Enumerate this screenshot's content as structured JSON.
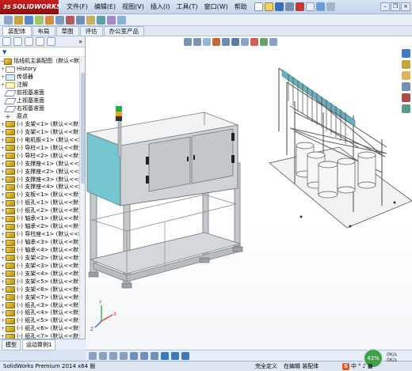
{
  "app": {
    "logo_prefix": "3S",
    "logo_text": "SOLIDWORKS",
    "menu": [
      "文件(F)",
      "编辑(E)",
      "视图(V)",
      "插入(I)",
      "工具(T)",
      "窗口(W)",
      "帮助"
    ]
  },
  "command_tabs": [
    "装配体",
    "布局",
    "草图",
    "评估",
    "办公室产品"
  ],
  "feature_tree": {
    "filter_icon": "filter-icon",
    "root": "括线机主装配图（默认<默认",
    "items": [
      {
        "label": "History",
        "icon": "hist"
      },
      {
        "label": "传感器",
        "icon": "sensor"
      },
      {
        "label": "注解",
        "icon": "note"
      },
      {
        "label": "前视基准面",
        "icon": "plane"
      },
      {
        "label": "上视基准面",
        "icon": "plane"
      },
      {
        "label": "右视基准面",
        "icon": "plane"
      },
      {
        "label": "原点",
        "icon": "origin"
      },
      {
        "label": "(-) 支架<1> (默认<<默认",
        "icon": "part"
      },
      {
        "label": "(-) 支架<1> (默认<<默认",
        "icon": "part"
      },
      {
        "label": "(-) 电机板<1> (默认<<默",
        "icon": "part"
      },
      {
        "label": "(-) 导柱<1> (默认<<默认",
        "icon": "part"
      },
      {
        "label": "(-) 导柱<2> (默认<<默认",
        "icon": "part"
      },
      {
        "label": "(-) 支撑座<1> (默认<<默",
        "icon": "part"
      },
      {
        "label": "(-) 支撑座<2> (默认<<默",
        "icon": "part"
      },
      {
        "label": "(-) 支撑座<3> (默认<<默",
        "icon": "part"
      },
      {
        "label": "(-) 支撑座<4> (默认<<默",
        "icon": "part"
      },
      {
        "label": "(-) 支板<1> (默认<<默认",
        "icon": "part"
      },
      {
        "label": "(-) 纸孔<1> (默认<<默认",
        "icon": "part"
      },
      {
        "label": "(-) 纸孔<2> (默认<<默认",
        "icon": "part"
      },
      {
        "label": "(-) 轴承<1> (默认<<默认",
        "icon": "part"
      },
      {
        "label": "(-) 轴承<2> (默认<<默认",
        "icon": "part"
      },
      {
        "label": "(-) 导柱座<1> (默认<<默",
        "icon": "part"
      },
      {
        "label": "(-) 轴承<3> (默认<<默认",
        "icon": "part"
      },
      {
        "label": "(-) 轴承<4> (默认<<默认",
        "icon": "part"
      },
      {
        "label": "(-) 支架<2> (默认<<默认",
        "icon": "part"
      },
      {
        "label": "(-) 支架<3> (默认<<默认",
        "icon": "part"
      },
      {
        "label": "(-) 支架<4> (默认<<默认",
        "icon": "part"
      },
      {
        "label": "(-) 支架<5> (默认<<默认",
        "icon": "part"
      },
      {
        "label": "(-) 支架<6> (默认<<默认",
        "icon": "part"
      },
      {
        "label": "(-) 支架<7> (默认<<默认",
        "icon": "part"
      },
      {
        "label": "(-) 纸孔<3> (默认<<默认",
        "icon": "part"
      },
      {
        "label": "(-) 纸孔<4> (默认<<默认",
        "icon": "part"
      },
      {
        "label": "(-) 纸孔<5> (默认<<默认",
        "icon": "part"
      },
      {
        "label": "(-) 纸孔<6> (默认<<默认",
        "icon": "part"
      },
      {
        "label": "(-) 纸孔<7> (默认<<默认",
        "icon": "part"
      }
    ]
  },
  "left_bottom_tabs": [
    "模型",
    "运动算例1"
  ],
  "status": {
    "app_version": "SolidWorks Premium 2014 x64 版",
    "state": "完全定义",
    "mode": "在编辑 装配体",
    "zoom": "43%",
    "net_up": "0K/s",
    "net_down": "0K/s",
    "ime_lang": "中"
  },
  "colors": {
    "cabinet_side": "#76c6cf",
    "cabinet_panel": "#c8c8c8",
    "frame": "#b9bec4",
    "rack_top": "#6cb0c0"
  }
}
